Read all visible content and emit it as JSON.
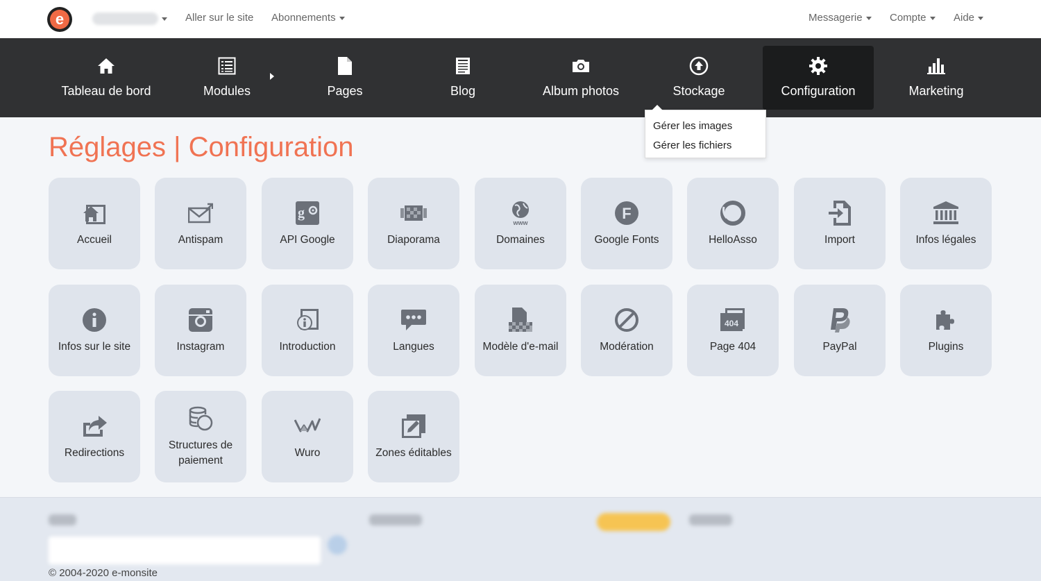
{
  "topbar": {
    "logo_letter": "e",
    "links": {
      "site": "Aller sur le site",
      "subscriptions": "Abonnements",
      "messaging": "Messagerie",
      "account": "Compte",
      "help": "Aide"
    }
  },
  "nav": {
    "items": [
      {
        "label": "Tableau de bord",
        "icon": "home-icon"
      },
      {
        "label": "Modules",
        "icon": "list-icon"
      },
      {
        "label": "Pages",
        "icon": "page-icon"
      },
      {
        "label": "Blog",
        "icon": "blog-icon"
      },
      {
        "label": "Album photos",
        "icon": "camera-icon"
      },
      {
        "label": "Stockage",
        "icon": "upload-circle-icon"
      },
      {
        "label": "Configuration",
        "icon": "gear-icon",
        "active": true
      },
      {
        "label": "Marketing",
        "icon": "bar-chart-icon"
      }
    ],
    "dropdown": [
      "Gérer les images",
      "Gérer les fichiers"
    ]
  },
  "page_title": "Réglages | Configuration",
  "tiles": [
    {
      "label": "Accueil",
      "icon": "home-frame-icon"
    },
    {
      "label": "Antispam",
      "icon": "envelope-icon"
    },
    {
      "label": "API Google",
      "icon": "google-settings-icon"
    },
    {
      "label": "Diaporama",
      "icon": "slideshow-icon"
    },
    {
      "label": "Domaines",
      "icon": "globe-www-icon"
    },
    {
      "label": "Google Fonts",
      "icon": "font-f-icon"
    },
    {
      "label": "HelloAsso",
      "icon": "helloasso-icon"
    },
    {
      "label": "Import",
      "icon": "import-icon"
    },
    {
      "label": "Infos légales",
      "icon": "bank-icon"
    },
    {
      "label": "Infos sur le site",
      "icon": "info-icon"
    },
    {
      "label": "Instagram",
      "icon": "instagram-icon"
    },
    {
      "label": "Introduction",
      "icon": "intro-info-icon"
    },
    {
      "label": "Langues",
      "icon": "speech-bubble-icon"
    },
    {
      "label": "Modèle d'e-mail",
      "icon": "template-icon"
    },
    {
      "label": "Modération",
      "icon": "ban-icon"
    },
    {
      "label": "Page 404",
      "icon": "page-404-icon"
    },
    {
      "label": "PayPal",
      "icon": "paypal-icon"
    },
    {
      "label": "Plugins",
      "icon": "puzzle-icon"
    },
    {
      "label": "Redirections",
      "icon": "share-arrow-icon"
    },
    {
      "label": "Structures de paiement",
      "icon": "coins-icon"
    },
    {
      "label": "Wuro",
      "icon": "wuro-icon"
    },
    {
      "label": "Zones éditables",
      "icon": "edit-zone-icon"
    }
  ],
  "footer": {
    "copyright": "© 2004-2020 e-monsite"
  },
  "colors": {
    "accent": "#f07353",
    "nav_bg": "#303133",
    "nav_active": "#1b1c1d",
    "tile_bg": "#dfe4ec",
    "icon": "#6b7079"
  }
}
